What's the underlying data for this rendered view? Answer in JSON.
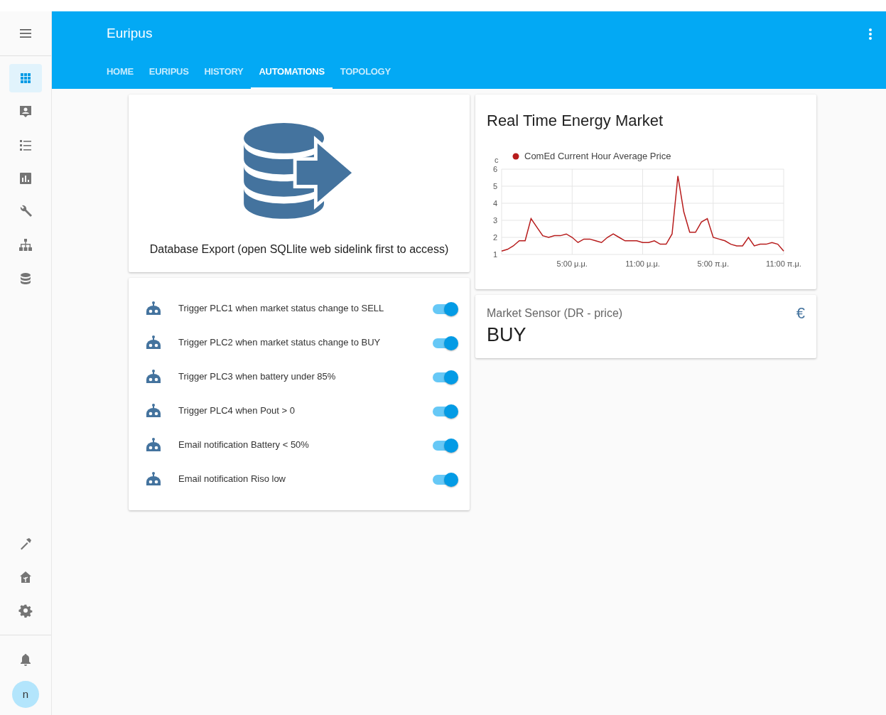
{
  "sidebar": {
    "items": [
      {
        "selected": true
      },
      {
        "selected": false
      },
      {
        "selected": false
      },
      {
        "selected": false
      },
      {
        "selected": false
      },
      {
        "selected": false
      },
      {
        "selected": false
      }
    ],
    "bottom_items": [
      {
        "selected": false
      },
      {
        "selected": false
      },
      {
        "selected": false
      }
    ],
    "avatar": "n"
  },
  "header": {
    "title": "Euripus",
    "tabs": [
      {
        "label": "HOME",
        "selected": false
      },
      {
        "label": "EURIPUS",
        "selected": false
      },
      {
        "label": "HISTORY",
        "selected": false
      },
      {
        "label": "AUTOMATIONS",
        "selected": true
      },
      {
        "label": "TOPOLOGY",
        "selected": false
      }
    ]
  },
  "database_card": {
    "caption": "Database Export (open SQLlite web sidelink first to access)"
  },
  "automations": [
    {
      "name": "Trigger PLC1 when market status change to SELL",
      "on": true
    },
    {
      "name": "Trigger PLC2 when market status change to BUY",
      "on": true
    },
    {
      "name": "Trigger PLC3 when battery under 85%",
      "on": true
    },
    {
      "name": "Trigger PLC4 when Pout > 0",
      "on": true
    },
    {
      "name": "Email notification Battery < 50%",
      "on": true
    },
    {
      "name": "Email notification Riso low",
      "on": true
    }
  ],
  "energy_card": {
    "title": "Real Time Energy Market",
    "chart_data": {
      "type": "line",
      "ylabel": "c",
      "categories": [
        null,
        null,
        null,
        null,
        null,
        null,
        null,
        null,
        null,
        null,
        null,
        null,
        "5:00 μ.μ.",
        null,
        null,
        null,
        null,
        null,
        null,
        null,
        null,
        null,
        null,
        null,
        "11:00 μ.μ.",
        null,
        null,
        null,
        null,
        null,
        null,
        null,
        null,
        null,
        null,
        null,
        "5:00 π.μ.",
        null,
        null,
        null,
        null,
        null,
        null,
        null,
        null,
        null,
        null,
        null,
        "11:00 π.μ."
      ],
      "series": [
        {
          "name": "ComEd Current Hour Average Price",
          "color": "#b71c1c",
          "values": [
            1.2,
            1.3,
            1.5,
            1.8,
            1.8,
            3.1,
            2.6,
            2.1,
            2.0,
            2.1,
            2.1,
            2.2,
            2.0,
            1.7,
            1.9,
            1.9,
            1.8,
            1.7,
            2.0,
            2.2,
            2.0,
            1.8,
            1.8,
            1.8,
            1.7,
            1.7,
            1.8,
            1.6,
            1.6,
            2.2,
            5.6,
            3.5,
            2.3,
            2.3,
            2.9,
            3.1,
            2.0,
            1.9,
            1.8,
            1.6,
            1.5,
            1.5,
            2.0,
            1.5,
            1.6,
            1.6,
            1.7,
            1.6,
            1.2
          ]
        }
      ],
      "ylim": [
        1,
        6
      ],
      "grid": true,
      "yticks": [
        1,
        2,
        3,
        4,
        5,
        6
      ]
    }
  },
  "sensor_card": {
    "label": "Market Sensor (DR - price)",
    "icon": "€",
    "state": "BUY"
  }
}
